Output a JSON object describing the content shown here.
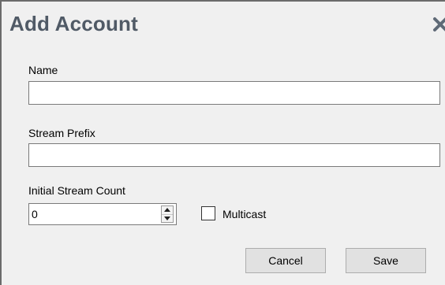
{
  "dialog": {
    "title": "Add Account",
    "close_icon": "close-icon"
  },
  "form": {
    "name_label": "Name",
    "name_value": "",
    "stream_prefix_label": "Stream Prefix",
    "stream_prefix_value": "",
    "initial_stream_count_label": "Initial Stream Count",
    "initial_stream_count_value": "0",
    "multicast_label": "Multicast",
    "multicast_checked": false
  },
  "buttons": {
    "cancel_label": "Cancel",
    "save_label": "Save"
  },
  "colors": {
    "dialog_background": "#f0f0f0",
    "title_text": "#505a66",
    "button_background": "#e1e1e1",
    "input_border": "#7a7a7a"
  }
}
